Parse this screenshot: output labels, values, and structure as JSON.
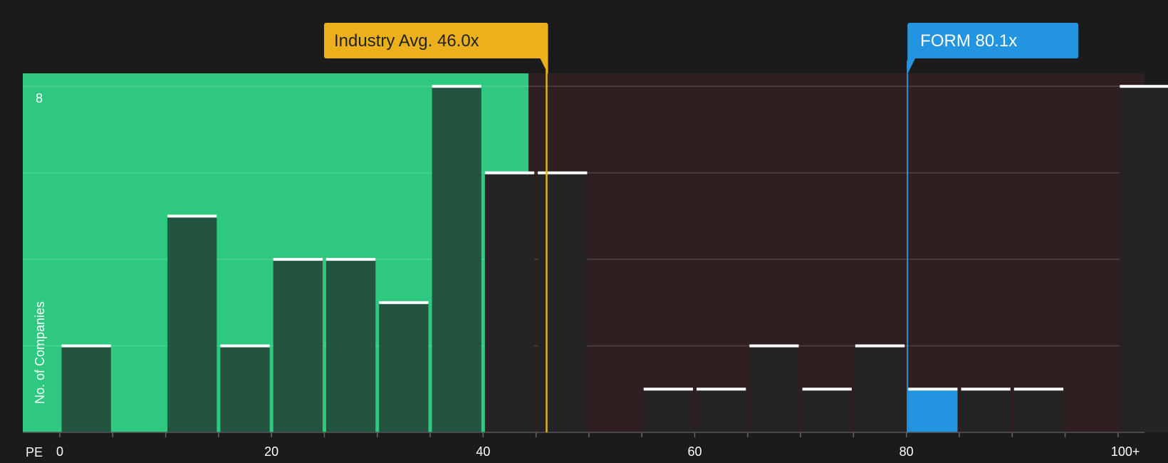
{
  "chart_data": {
    "type": "bar",
    "xlabel": "PE",
    "ylabel": "No. of Companies",
    "xlim": [
      -3.5,
      102.5
    ],
    "ylim": [
      0,
      8.3
    ],
    "x_ticks": [
      0,
      20,
      40,
      60,
      80,
      100
    ],
    "x_tick_labels": [
      "0",
      "20",
      "40",
      "60",
      "80",
      "100+"
    ],
    "y_ticks": [
      8
    ],
    "y_tick_labels": [
      "8"
    ],
    "y_gridlines": [
      2,
      4,
      6,
      8
    ],
    "bin_width": 5,
    "bins": [
      {
        "start": 0,
        "count": 2
      },
      {
        "start": 5,
        "count": 0
      },
      {
        "start": 10,
        "count": 5
      },
      {
        "start": 15,
        "count": 2
      },
      {
        "start": 20,
        "count": 4
      },
      {
        "start": 25,
        "count": 4
      },
      {
        "start": 30,
        "count": 3
      },
      {
        "start": 35,
        "count": 8
      },
      {
        "start": 40,
        "count": 6
      },
      {
        "start": 45,
        "count": 6
      },
      {
        "start": 50,
        "count": 0
      },
      {
        "start": 55,
        "count": 1
      },
      {
        "start": 60,
        "count": 1
      },
      {
        "start": 65,
        "count": 2
      },
      {
        "start": 70,
        "count": 1
      },
      {
        "start": 75,
        "count": 2
      },
      {
        "start": 80,
        "count": 1
      },
      {
        "start": 85,
        "count": 1
      },
      {
        "start": 90,
        "count": 1
      },
      {
        "start": 95,
        "count": 0
      },
      {
        "start": 100,
        "count": 8
      }
    ],
    "highlight_bin_start": 80,
    "undervalued_region_end": 44.3,
    "industry_avg": {
      "label": "Industry Avg. 46.0x",
      "value": 46.0
    },
    "company": {
      "label": "FORM 80.1x",
      "value": 80.1
    },
    "colors": {
      "background": "#1b1b1b",
      "green_region": "#2ec880",
      "red_region": "#2f1f20",
      "bar_dark": "#242424",
      "bar_on_green": "#234a3a",
      "highlight_bar": "#2394e0",
      "bar_cap": "#ffffff",
      "industry": "#ecb01c",
      "company": "#2394e0"
    }
  }
}
